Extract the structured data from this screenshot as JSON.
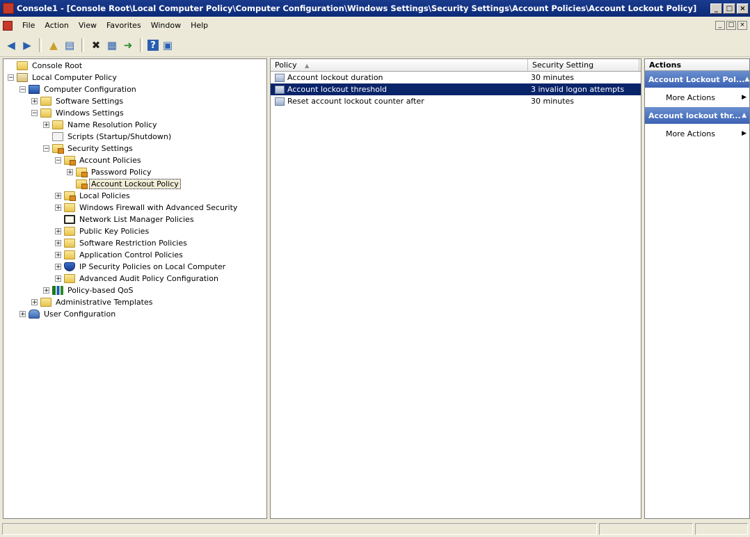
{
  "window": {
    "title": "Console1 - [Console Root\\Local Computer Policy\\Computer Configuration\\Windows Settings\\Security Settings\\Account Policies\\Account Lockout Policy]",
    "minimize": "_",
    "maximize": "□",
    "close": "×"
  },
  "menu": {
    "items": [
      {
        "label": "File"
      },
      {
        "label": "Action"
      },
      {
        "label": "View"
      },
      {
        "label": "Favorites"
      },
      {
        "label": "Window"
      },
      {
        "label": "Help"
      }
    ],
    "mdi": [
      "_",
      "□",
      "×"
    ]
  },
  "toolbar": {
    "buttons": [
      {
        "name": "back-icon",
        "glyph": "◀"
      },
      {
        "name": "forward-icon",
        "glyph": "▶"
      },
      {
        "name": "up-folder-icon",
        "glyph": "▲"
      },
      {
        "name": "show-hide-tree-icon",
        "glyph": "▤"
      },
      {
        "name": "delete-icon",
        "glyph": "✖"
      },
      {
        "name": "properties-icon",
        "glyph": "▦"
      },
      {
        "name": "export-list-icon",
        "glyph": "➜"
      },
      {
        "name": "help-icon",
        "glyph": "?"
      },
      {
        "name": "show-action-pane-icon",
        "glyph": "▣"
      }
    ]
  },
  "tree": {
    "items": [
      {
        "label": "Console Root",
        "level": 0,
        "expander": "none",
        "icon": "folder"
      },
      {
        "label": "Local Computer Policy",
        "level": 0,
        "expander": "minus",
        "icon": "book"
      },
      {
        "label": "Computer Configuration",
        "level": 1,
        "expander": "minus",
        "icon": "pc"
      },
      {
        "label": "Software Settings",
        "level": 2,
        "expander": "plus",
        "icon": "folder"
      },
      {
        "label": "Windows Settings",
        "level": 2,
        "expander": "minus",
        "icon": "folder"
      },
      {
        "label": "Name Resolution Policy",
        "level": 3,
        "expander": "plus",
        "icon": "folder"
      },
      {
        "label": "Scripts (Startup/Shutdown)",
        "level": 3,
        "expander": "none",
        "icon": "doc"
      },
      {
        "label": "Security Settings",
        "level": 3,
        "expander": "minus",
        "icon": "folder-lock"
      },
      {
        "label": "Account Policies",
        "level": 4,
        "expander": "minus",
        "icon": "folder-lock"
      },
      {
        "label": "Password Policy",
        "level": 5,
        "expander": "plus",
        "icon": "folder-lock"
      },
      {
        "label": "Account Lockout Policy",
        "level": 5,
        "expander": "none",
        "icon": "folder-lock",
        "selected": true
      },
      {
        "label": "Local Policies",
        "level": 4,
        "expander": "plus",
        "icon": "folder-lock"
      },
      {
        "label": "Windows Firewall with Advanced Security",
        "level": 4,
        "expander": "plus",
        "icon": "folder"
      },
      {
        "label": "Network List Manager Policies",
        "level": 4,
        "expander": "none",
        "icon": "net"
      },
      {
        "label": "Public Key Policies",
        "level": 4,
        "expander": "plus",
        "icon": "folder"
      },
      {
        "label": "Software Restriction Policies",
        "level": 4,
        "expander": "plus",
        "icon": "folder"
      },
      {
        "label": "Application Control Policies",
        "level": 4,
        "expander": "plus",
        "icon": "folder"
      },
      {
        "label": "IP Security Policies on Local Computer",
        "level": 4,
        "expander": "plus",
        "icon": "shield"
      },
      {
        "label": "Advanced Audit Policy Configuration",
        "level": 4,
        "expander": "plus",
        "icon": "folder"
      },
      {
        "label": "Policy-based QoS",
        "level": 3,
        "expander": "plus",
        "icon": "chart"
      },
      {
        "label": "Administrative Templates",
        "level": 2,
        "expander": "plus",
        "icon": "folder"
      },
      {
        "label": "User Configuration",
        "level": 1,
        "expander": "plus",
        "icon": "user"
      }
    ]
  },
  "list": {
    "columns": [
      "Policy",
      "Security Setting"
    ],
    "sort_indicator": "▲",
    "rows": [
      {
        "policy": "Account lockout duration",
        "setting": "30 minutes"
      },
      {
        "policy": "Account lockout threshold",
        "setting": "3 invalid logon attempts",
        "selected": true
      },
      {
        "policy": "Reset account lockout counter after",
        "setting": "30 minutes"
      }
    ]
  },
  "actions": {
    "title": "Actions",
    "sections": [
      {
        "header": "Account Lockout Pol...",
        "items": [
          "More Actions"
        ]
      },
      {
        "header": "Account lockout thr...",
        "items": [
          "More Actions"
        ]
      }
    ]
  },
  "colors": {
    "titlebar": "#0b2a78",
    "selection": "#0a246a",
    "action_header": "#3b62b3"
  }
}
